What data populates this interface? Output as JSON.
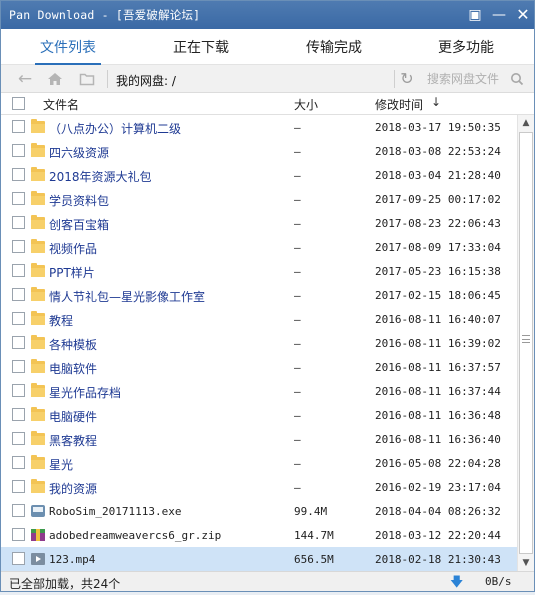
{
  "window": {
    "title": "Pan Download - [吾爱破解论坛]",
    "restore_icon": "restore-icon",
    "minimize_icon": "minimize-icon",
    "close_icon": "close-icon"
  },
  "tabs": [
    {
      "label": "文件列表",
      "active": true
    },
    {
      "label": "正在下载",
      "active": false
    },
    {
      "label": "传输完成",
      "active": false
    },
    {
      "label": "更多功能",
      "active": false
    }
  ],
  "toolbar": {
    "path_label": "我的网盘: /",
    "search_placeholder": "搜索网盘文件",
    "back_icon": "arrow-left-icon",
    "home_icon": "home-icon",
    "folder_icon": "folder-icon",
    "refresh_icon": "refresh-icon",
    "search_icon": "search-icon"
  },
  "columns": {
    "name": "文件名",
    "size": "大小",
    "time": "修改时间",
    "sort_indicator": "↓"
  },
  "files": [
    {
      "name": "（八点办公）计算机二级",
      "size": "–",
      "time": "2018-03-17 19:50:35",
      "type": "folder"
    },
    {
      "name": "四六级资源",
      "size": "–",
      "time": "2018-03-08 22:53:24",
      "type": "folder"
    },
    {
      "name": "2018年资源大礼包",
      "size": "–",
      "time": "2018-03-04 21:28:40",
      "type": "folder"
    },
    {
      "name": "学员资料包",
      "size": "–",
      "time": "2017-09-25 00:17:02",
      "type": "folder"
    },
    {
      "name": "创客百宝箱",
      "size": "–",
      "time": "2017-08-23 22:06:43",
      "type": "folder"
    },
    {
      "name": "视频作品",
      "size": "–",
      "time": "2017-08-09 17:33:04",
      "type": "folder"
    },
    {
      "name": "PPT样片",
      "size": "–",
      "time": "2017-05-23 16:15:38",
      "type": "folder"
    },
    {
      "name": "情人节礼包—星光影像工作室",
      "size": "–",
      "time": "2017-02-15 18:06:45",
      "type": "folder"
    },
    {
      "name": "教程",
      "size": "–",
      "time": "2016-08-11 16:40:07",
      "type": "folder"
    },
    {
      "name": "各种模板",
      "size": "–",
      "time": "2016-08-11 16:39:02",
      "type": "folder"
    },
    {
      "name": "电脑软件",
      "size": "–",
      "time": "2016-08-11 16:37:57",
      "type": "folder"
    },
    {
      "name": "星光作品存档",
      "size": "–",
      "time": "2016-08-11 16:37:44",
      "type": "folder"
    },
    {
      "name": "电脑硬件",
      "size": "–",
      "time": "2016-08-11 16:36:48",
      "type": "folder"
    },
    {
      "name": "黑客教程",
      "size": "–",
      "time": "2016-08-11 16:36:40",
      "type": "folder"
    },
    {
      "name": "星光",
      "size": "–",
      "time": "2016-05-08 22:04:28",
      "type": "folder"
    },
    {
      "name": "我的资源",
      "size": "–",
      "time": "2016-02-19 23:17:04",
      "type": "folder"
    },
    {
      "name": "RoboSim_20171113.exe",
      "size": "99.4M",
      "time": "2018-04-04 08:26:32",
      "type": "exe"
    },
    {
      "name": "adobedreamweavercs6_gr.zip",
      "size": "144.7M",
      "time": "2018-03-12 22:20:44",
      "type": "zip"
    },
    {
      "name": "123.mp4",
      "size": "656.5M",
      "time": "2018-02-18 21:30:43",
      "type": "mp4",
      "selected": true
    }
  ],
  "scrollbar": {
    "up_icon": "scroll-up-arrow-icon",
    "down_icon": "scroll-down-arrow-icon"
  },
  "status": {
    "text": "已全部加载，共24个",
    "speed": "0B/s",
    "download_icon": "download-arrow-icon",
    "accent_color": "#2b83d6"
  }
}
